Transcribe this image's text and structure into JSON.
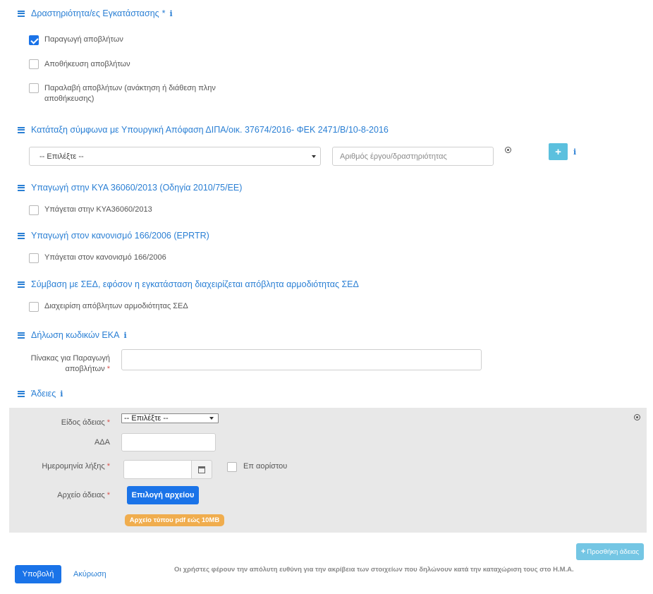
{
  "activities": {
    "title": "Δραστηριότητα/ες Εγκατάστασης",
    "required_mark": "*",
    "options": [
      {
        "label": "Παραγωγή αποβλήτων",
        "checked": true
      },
      {
        "label": "Αποθήκευση αποβλήτων",
        "checked": false
      },
      {
        "label": "Παραλαβή αποβλήτων (ανάκτηση ή διάθεση πλην αποθήκευσης)",
        "checked": false
      }
    ]
  },
  "classification": {
    "title": "Κατάταξη σύμφωνα με Υπουργική Απόφαση ΔΙΠΑ/οικ. 37674/2016- ΦΕΚ 2471/Β/10-8-2016",
    "select_value": "-- Επιλέξτε --",
    "project_placeholder": "Αριθμός έργου/δραστηριότητας",
    "add_label": "+"
  },
  "kya": {
    "title": "Υπαγωγή στην ΚΥΑ 36060/2013 (Οδηγία 2010/75/ΕΕ)",
    "checkbox_label": "Υπάγεται στην ΚΥΑ36060/2013"
  },
  "eprtr": {
    "title": "Υπαγωγή στον κανονισμό 166/2006 (EPRTR)",
    "checkbox_label": "Υπάγεται στον κανονισμό 166/2006"
  },
  "sed": {
    "title": "Σύμβαση με ΣΕΔ, εφόσον η εγκατάσταση διαχειρίζεται απόβλητα αρμοδιότητας ΣΕΔ",
    "checkbox_label": "Διαχειρίση απόβλητων αρμοδιότητας ΣΕΔ"
  },
  "eka": {
    "title": "Δήλωση κωδικών ΕΚΑ",
    "table_label_line1": "Πίνακας για Παραγωγή",
    "table_label_line2": "αποβλήτων",
    "required_mark": "*"
  },
  "permits": {
    "title": "Άδειες",
    "type_label": "Είδος άδειας",
    "type_value": "-- Επιλέξτε --",
    "ada_label": "ΑΔΑ",
    "expiry_label": "Ημερομηνία λήξης",
    "indefinite_label": "Επ αορίστου",
    "file_label": "Αρχείο άδειας",
    "file_button": "Επιλογή αρχείου",
    "file_hint": "Αρχείο τύπου pdf εώς 10MB",
    "required_mark": "*",
    "add_button": "Προσθήκη άδειας",
    "add_icon": "+"
  },
  "footer": {
    "submit": "Υποβολή",
    "cancel": "Ακύρωση",
    "disclaimer": "Οι χρήστες φέρουν την απόλυτη ευθύνη για την ακρίβεια των στοιχείων που δηλώνουν κατά την καταχώριση τους στο Η.Μ.Α."
  },
  "icons": {
    "menu": "menu-icon",
    "info": "info-icon",
    "remove": "remove-circle-icon",
    "calendar": "calendar-icon"
  },
  "colors": {
    "accent": "#2a7fd4",
    "primary_button": "#1a73e8",
    "info_button": "#5bc0de",
    "warning_badge": "#f0ad4e",
    "required": "#d9534f",
    "panel_bg": "#e8e8e8"
  }
}
